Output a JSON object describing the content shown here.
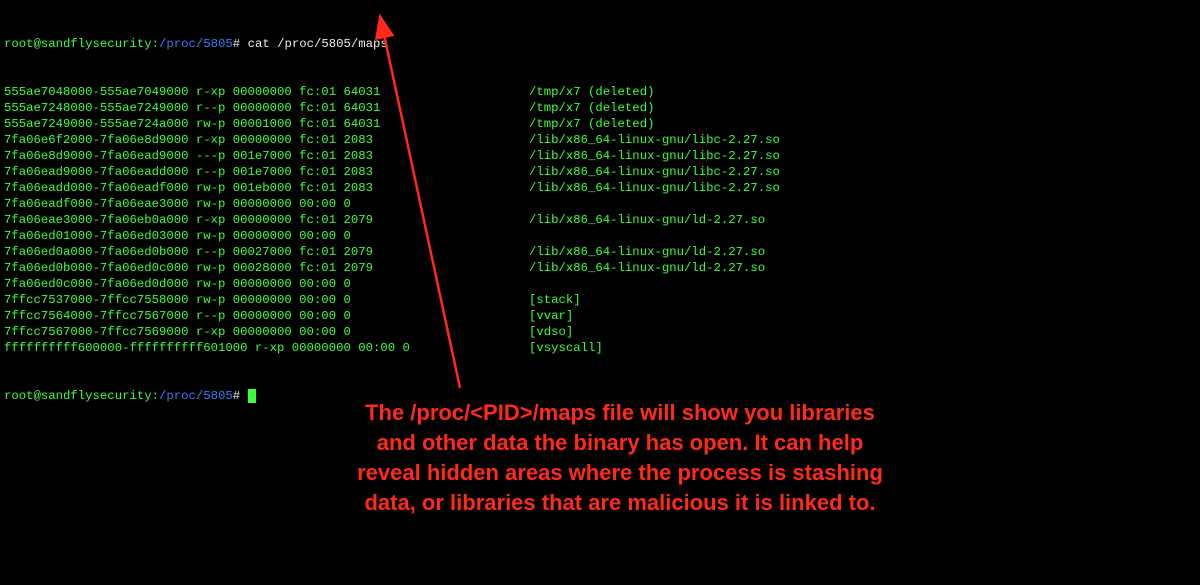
{
  "prompt": {
    "user": "root@sandflysecurity",
    "sep": ":",
    "path": "/proc/5805",
    "hash": "#"
  },
  "command": "cat /proc/5805/maps",
  "rows": [
    [
      "555ae7048000-555ae7049000 r-xp 00000000 fc:01 64031",
      "/tmp/x7 (deleted)"
    ],
    [
      "555ae7248000-555ae7249000 r--p 00000000 fc:01 64031",
      "/tmp/x7 (deleted)"
    ],
    [
      "555ae7249000-555ae724a000 rw-p 00001000 fc:01 64031",
      "/tmp/x7 (deleted)"
    ],
    [
      "7fa06e6f2000-7fa06e8d9000 r-xp 00000000 fc:01 2083",
      "/lib/x86_64-linux-gnu/libc-2.27.so"
    ],
    [
      "7fa06e8d9000-7fa06ead9000 ---p 001e7000 fc:01 2083",
      "/lib/x86_64-linux-gnu/libc-2.27.so"
    ],
    [
      "7fa06ead9000-7fa06eadd000 r--p 001e7000 fc:01 2083",
      "/lib/x86_64-linux-gnu/libc-2.27.so"
    ],
    [
      "7fa06eadd000-7fa06eadf000 rw-p 001eb000 fc:01 2083",
      "/lib/x86_64-linux-gnu/libc-2.27.so"
    ],
    [
      "7fa06eadf000-7fa06eae3000 rw-p 00000000 00:00 0",
      ""
    ],
    [
      "7fa06eae3000-7fa06eb0a000 r-xp 00000000 fc:01 2079",
      "/lib/x86_64-linux-gnu/ld-2.27.so"
    ],
    [
      "7fa06ed01000-7fa06ed03000 rw-p 00000000 00:00 0",
      ""
    ],
    [
      "7fa06ed0a000-7fa06ed0b000 r--p 00027000 fc:01 2079",
      "/lib/x86_64-linux-gnu/ld-2.27.so"
    ],
    [
      "7fa06ed0b000-7fa06ed0c000 rw-p 00028000 fc:01 2079",
      "/lib/x86_64-linux-gnu/ld-2.27.so"
    ],
    [
      "7fa06ed0c000-7fa06ed0d000 rw-p 00000000 00:00 0",
      ""
    ],
    [
      "7ffcc7537000-7ffcc7558000 rw-p 00000000 00:00 0",
      "[stack]"
    ],
    [
      "7ffcc7564000-7ffcc7567000 r--p 00000000 00:00 0",
      "[vvar]"
    ],
    [
      "7ffcc7567000-7ffcc7569000 r-xp 00000000 00:00 0",
      "[vdso]"
    ],
    [
      "ffffffffff600000-ffffffffff601000 r-xp 00000000 00:00 0",
      "[vsyscall]"
    ]
  ],
  "annotation": "The /proc/<PID>/maps file will show you libraries and other data the binary has open. It can help reveal hidden areas where the process is stashing data, or libraries that are malicious it is linked to.",
  "colors": {
    "bg": "#000000",
    "green": "#3cff3c",
    "blue": "#3a7bff",
    "white": "#eeeeee",
    "red": "#ff2a1a"
  }
}
